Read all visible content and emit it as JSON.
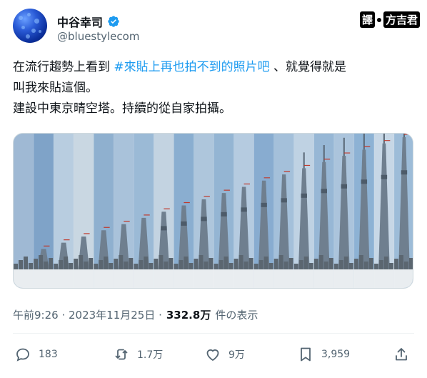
{
  "author": {
    "display_name": "中谷幸司",
    "handle": "@bluestylecom",
    "verified_icon": "verified-badge-icon"
  },
  "translator": {
    "label": "譯",
    "name": "方吉君"
  },
  "tweet": {
    "line1_pre": "在流行趨勢上看到 ",
    "hashtag": "#來貼上再也拍不到的照片吧",
    "line1_post": " 、就覺得就是",
    "line2": "叫我來貼這個。",
    "line3": "建設中東京晴空塔。持續的從自家拍攝。"
  },
  "media": {
    "description_icon": "skytree-construction-photo"
  },
  "meta": {
    "time": "午前9:26 · 2023年11月25日 · ",
    "views": "332.8万",
    "views_suffix": "件の表示"
  },
  "actions": {
    "reply_count": "183",
    "retweet_count": "1.7万",
    "like_count": "9万",
    "bookmark_count": "3,959"
  },
  "colors": {
    "accent": "#1d9bf0",
    "text": "#0f1419",
    "muted": "#536471"
  }
}
